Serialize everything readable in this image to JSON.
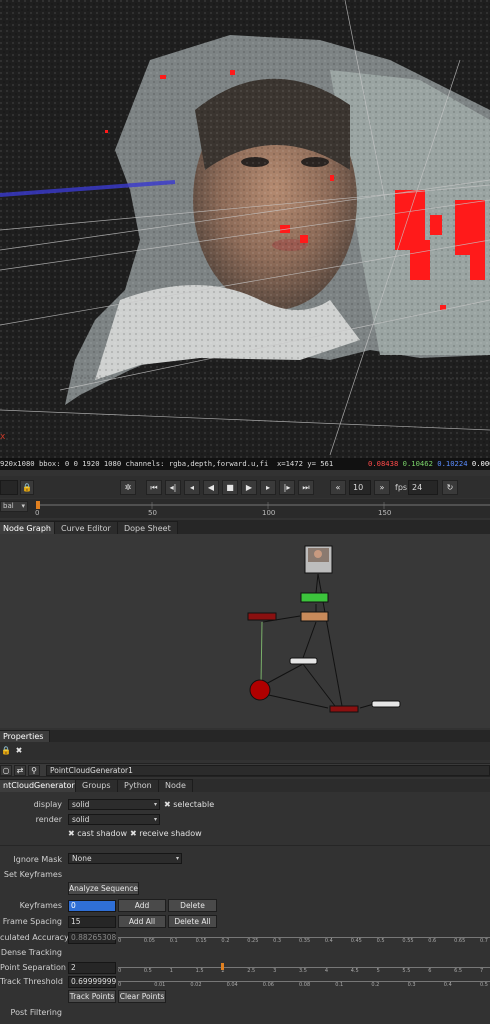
{
  "viewer": {
    "axis_label": "x",
    "info": {
      "format": "920x1080 bbox: 0 0 1920 1080 channels: rgba,depth,forward.u,fi",
      "coords": "x=1472 y= 561",
      "r": "0.08438",
      "g": "0.10462",
      "b": "0.10224",
      "a": "0.000"
    }
  },
  "transport": {
    "icons": [
      "gear-icon",
      "skip-start-icon",
      "prev-keyframe-icon",
      "step-back-icon",
      "play-back-icon",
      "stop-icon",
      "play-forward-icon",
      "step-forward-icon",
      "next-keyframe-icon",
      "skip-end-icon",
      "jump-back-icon",
      "jump-forward-icon",
      "loop-icon"
    ],
    "increment": "10",
    "fps_label": "fps",
    "fps": "24",
    "range_mode": "bal",
    "ticks": [
      "0",
      "50",
      "100",
      "150"
    ]
  },
  "graph_tabs": [
    "Node Graph",
    "Curve Editor",
    "Dope Sheet"
  ],
  "properties": {
    "panel_title": "Properties",
    "node_name": "PointCloudGenerator1",
    "tabs": [
      "ntCloudGenerator",
      "Groups",
      "Python",
      "Node"
    ],
    "display_label": "display",
    "display_value": "solid",
    "selectable_label": "selectable",
    "render_label": "render",
    "render_value": "solid",
    "cast_shadow_label": "cast shadow",
    "receive_shadow_label": "receive shadow",
    "ignore_mask_label": "Ignore Mask",
    "ignore_mask_value": "None",
    "set_keyframes_label": "Set Keyframes",
    "analyze_button": "Analyze Sequence",
    "keyframes_label": "Keyframes",
    "keyframes_value": "0",
    "add_button": "Add",
    "delete_button": "Delete",
    "frame_spacing_label": "Frame Spacing",
    "frame_spacing_value": "15",
    "add_all_button": "Add All",
    "delete_all_button": "Delete All",
    "calc_accuracy_label": "culated Accuracy",
    "calc_accuracy_value": "0.88265308",
    "accuracy_ticks": [
      "0",
      "0.05",
      "0.1",
      "0.15",
      "0.2",
      "0.25",
      "0.3",
      "0.35",
      "0.4",
      "0.45",
      "0.5",
      "0.55",
      "0.6",
      "0.65",
      "0.7"
    ],
    "dense_tracking_label": "Dense Tracking",
    "point_sep_label": "Point Separation",
    "point_sep_value": "2",
    "point_sep_ticks": [
      "0",
      "0.5",
      "1",
      "1.5",
      "2",
      "2.5",
      "3",
      "3.5",
      "4",
      "4.5",
      "5",
      "5.5",
      "6",
      "6.5",
      "7"
    ],
    "track_threshold_label": "Track Threshold",
    "track_threshold_value": "0.69999999",
    "threshold_ticks": [
      "0",
      "0.01",
      "0.02",
      "0.04",
      "0.06",
      "0.08",
      "0.1",
      "0.2",
      "0.3",
      "0.4",
      "0.5"
    ],
    "track_points_button": "Track Points",
    "clear_points_button": "Clear Points",
    "post_filtering_label": "Post Filtering"
  },
  "colors": {
    "accent_blue": "#2f6fd6",
    "red_values": "#ff4a4a",
    "green_values": "#7bd36a",
    "blue_values": "#5a8cff"
  }
}
